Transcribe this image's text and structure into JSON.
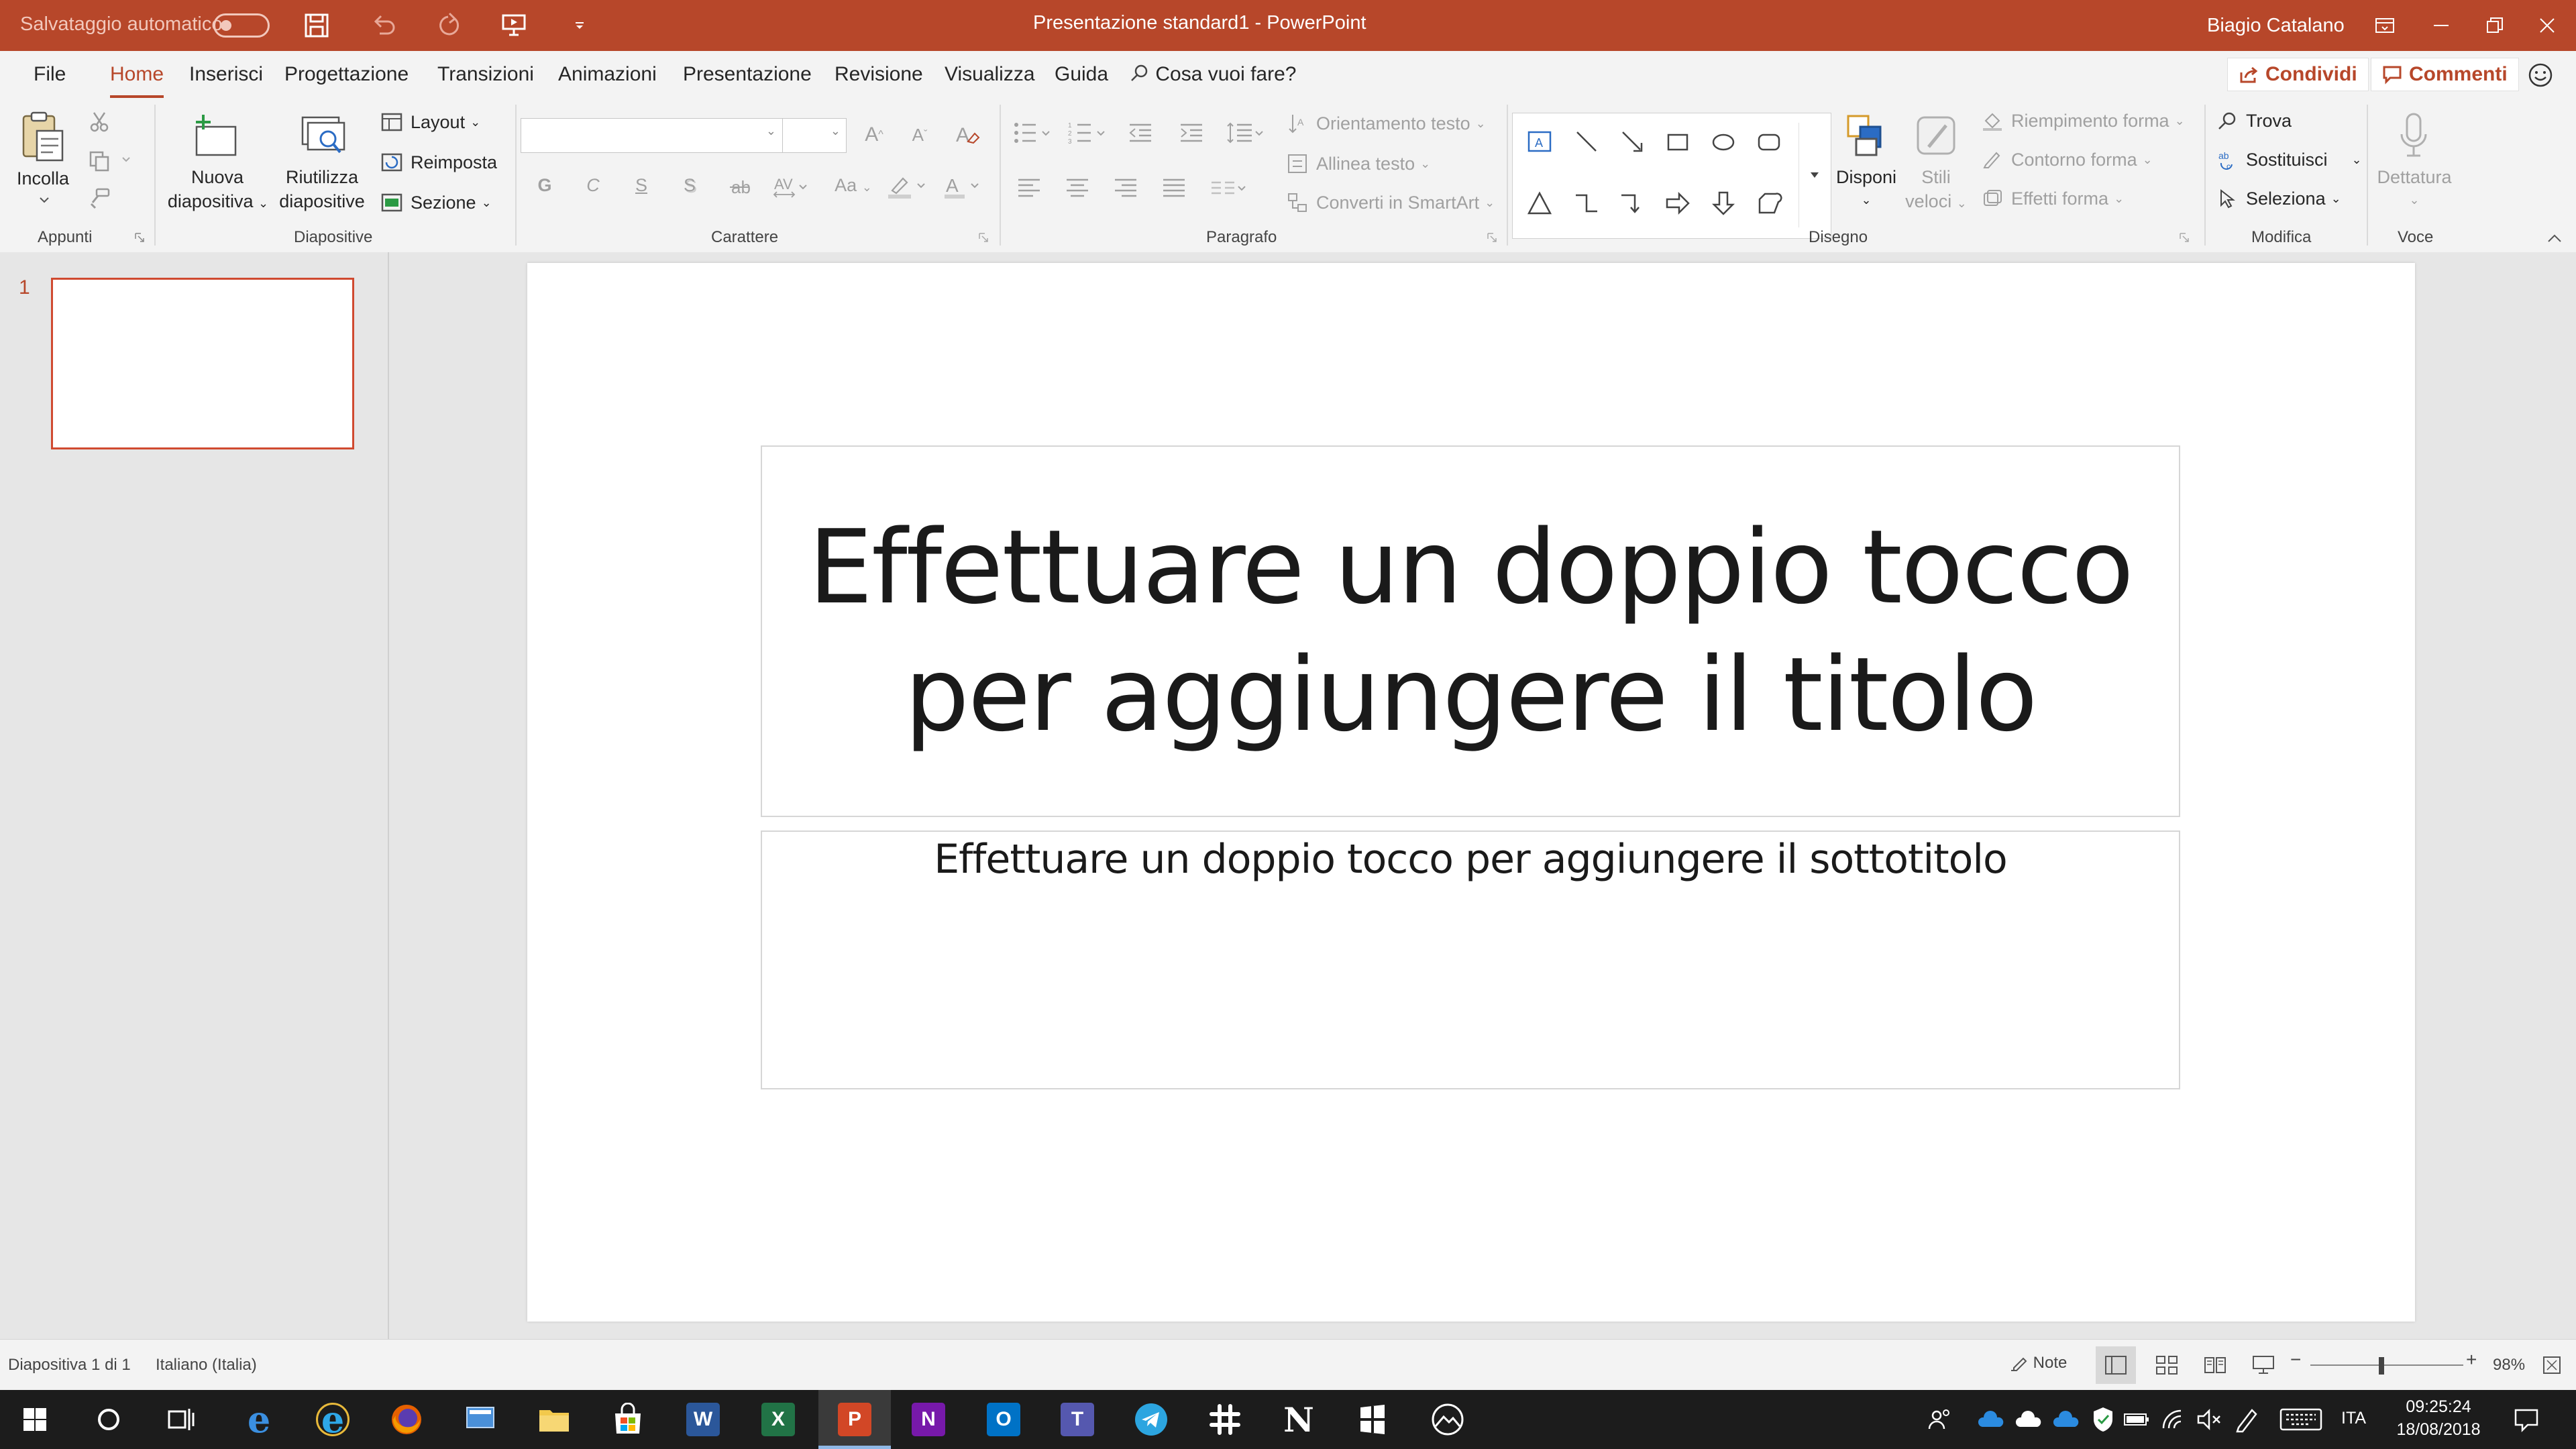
{
  "titlebar": {
    "autosave_label": "Salvataggio automatico",
    "document_title": "Presentazione standard1  -  PowerPoint",
    "user_name": "Biagio Catalano"
  },
  "tabs": [
    "File",
    "Home",
    "Inserisci",
    "Progettazione",
    "Transizioni",
    "Animazioni",
    "Presentazione",
    "Revisione",
    "Visualizza",
    "Guida"
  ],
  "active_tab": "Home",
  "tell_me": "Cosa vuoi fare?",
  "share": {
    "share_label": "Condividi",
    "comments_label": "Commenti"
  },
  "ribbon": {
    "clipboard": {
      "group": "Appunti",
      "paste": "Incolla"
    },
    "slides": {
      "group": "Diapositive",
      "new_slide_1": "Nuova",
      "new_slide_2": "diapositiva",
      "reuse_1": "Riutilizza",
      "reuse_2": "diapositive",
      "layout": "Layout",
      "reset": "Reimposta",
      "section": "Sezione"
    },
    "font": {
      "group": "Carattere",
      "bold": "G",
      "italic": "C",
      "underline": "S",
      "shadow": "S",
      "case": "Aa"
    },
    "paragraph": {
      "group": "Paragrafo",
      "text_direction": "Orientamento testo",
      "align_text": "Allinea testo",
      "smartart": "Converti in SmartArt"
    },
    "drawing": {
      "group": "Disegno",
      "arrange": "Disponi",
      "quick_styles_1": "Stili",
      "quick_styles_2": "veloci",
      "fill": "Riempimento forma",
      "outline": "Contorno forma",
      "effects": "Effetti forma"
    },
    "editing": {
      "group": "Modifica",
      "find": "Trova",
      "replace": "Sostituisci",
      "select": "Seleziona"
    },
    "voice": {
      "group": "Voce",
      "dictate": "Dettatura"
    }
  },
  "thumbnails": {
    "slide_number": "1"
  },
  "slide": {
    "title_line1": "Effettuare un doppio tocco",
    "title_line2": "per aggiungere il titolo",
    "subtitle": "Effettuare un doppio tocco per aggiungere il sottotitolo"
  },
  "statusbar": {
    "slide_info": "Diapositiva 1 di 1",
    "language": "Italiano (Italia)",
    "notes": "Note",
    "zoom_minus": "−",
    "zoom_plus": "+",
    "zoom": "98%"
  },
  "taskbar": {
    "keyboard_lang": "ITA",
    "time": "09:25:24",
    "date": "18/08/2018"
  },
  "colors": {
    "accent": "#b7472a",
    "ribbon_bg": "#f3f3f3",
    "workspace_bg": "#e6e6e6",
    "taskbar_bg": "#1c1c1c"
  }
}
